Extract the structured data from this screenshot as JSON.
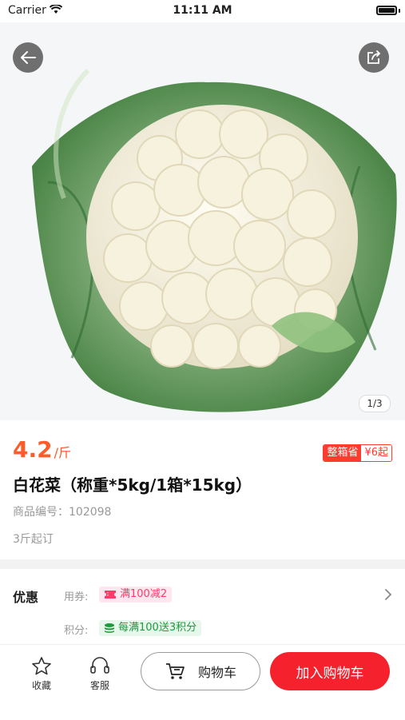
{
  "status_bar": {
    "carrier": "Carrier",
    "time": "11:11 AM"
  },
  "gallery": {
    "counter": "1/3"
  },
  "product": {
    "price": "4.2",
    "unit": "/斤",
    "badge_left": "整箱省",
    "badge_right": "¥6起",
    "name": "白花菜（称重*5kg/1箱*15kg）",
    "code": "商品编号：102098",
    "min_order": "3斤起订"
  },
  "promotions": {
    "title": "优惠",
    "coupon_label": "用券:",
    "coupon_text": "满100减2",
    "points_label": "积分:",
    "points_text": "每满100送3积分"
  },
  "bottom_bar": {
    "favorite": "收藏",
    "service": "客服",
    "cart": "购物车",
    "add_to_cart": "加入购物车"
  },
  "colors": {
    "price": "#ff5b2a",
    "accent": "#f5222d",
    "coupon": "#ff3b6b",
    "points": "#1f9a3e"
  }
}
